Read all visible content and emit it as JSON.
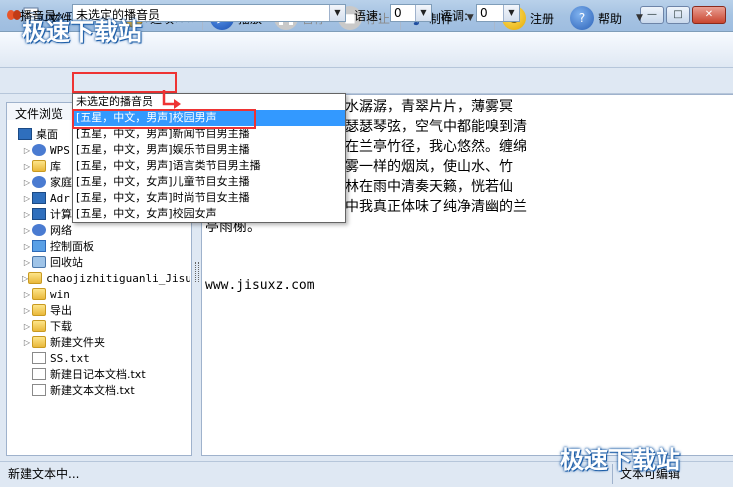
{
  "window": {
    "title": "jisuxz.TXT.txt - 文本转语音合成系统 9.1",
    "controls": {
      "minimize": "—",
      "maximize": "□",
      "close": "✕"
    }
  },
  "toolbar": {
    "file": "文件",
    "options": "选项",
    "play": "播放",
    "pause": "暂停",
    "stop": "停止",
    "make": "制作",
    "register": "注册",
    "help": "帮助"
  },
  "optionbar": {
    "announcer_label": "播音员：",
    "announcer_value": "未选定的播音员",
    "speed_label": "语速:",
    "speed_value": "0",
    "pitch_label": "语调:",
    "pitch_value": "0"
  },
  "announcer_options": [
    "未选定的播音员",
    "[五星，中文，男声]校园男声",
    "[五星，中文，男声]新闻节目男主播",
    "[五星，中文，男声]娱乐节目男主播",
    "[五星，中文，男声]语言类节目男主播",
    "[五星，中文，女声]儿童节目女主播",
    "[五星，中文，女声]时尚节目女主播",
    "[五星，中文，女声]校园女声"
  ],
  "left_panel": {
    "tab": "文件浏览",
    "tree": [
      {
        "label": "桌面",
        "type": "pc",
        "indent": 0
      },
      {
        "label": "WPS",
        "type": "net",
        "indent": 1
      },
      {
        "label": "库",
        "type": "folder",
        "indent": 1
      },
      {
        "label": "家庭",
        "type": "net",
        "indent": 1
      },
      {
        "label": "Adr",
        "type": "pc",
        "indent": 1
      },
      {
        "label": "计算",
        "type": "pc",
        "indent": 1
      },
      {
        "label": "网络",
        "type": "net",
        "indent": 1
      },
      {
        "label": "控制面板",
        "type": "cpl",
        "indent": 1
      },
      {
        "label": "回收站",
        "type": "bin",
        "indent": 1
      },
      {
        "label": "chaojizhitiguanli_Jisux",
        "type": "folder",
        "indent": 1
      },
      {
        "label": "win",
        "type": "folder",
        "indent": 1
      },
      {
        "label": "导出",
        "type": "folder",
        "indent": 1
      },
      {
        "label": "下载",
        "type": "folder",
        "indent": 1
      },
      {
        "label": "新建文件夹",
        "type": "folder",
        "indent": 1
      },
      {
        "label": "SS.txt",
        "type": "doc",
        "indent": 1
      },
      {
        "label": "新建日记本文档.txt",
        "type": "doc",
        "indent": 1
      },
      {
        "label": "新建文本文档.txt",
        "type": "doc",
        "indent": 1
      }
    ]
  },
  "document": {
    "lines": [
      "水佳境，竹林清幽，溪水潺潺，青翠片片，薄雾冥",
      "如画。风拂过竹林拂动瑟瑟琴弦，空气中都能嗅到清",
      "和书香文融弥漫。漫步在兰亭竹径，我心悠然。缠绵",
      "幕幔，从山谷中飘来的雾一样的烟岚，使山水、竹",
      "问灵动，青翠欲滴的竹林在雨中清奏天籁，恍若仙",
      "意而空灵，在细雨蒙蒙中我真正体味了纯净清幽的兰",
      "亭雨榭。"
    ],
    "url": "www.jisuxz.com"
  },
  "status": {
    "left": "新建文本中...",
    "right": "文本可编辑"
  },
  "watermarks": {
    "top": "极速下载站",
    "bottom": "极速下载站"
  }
}
